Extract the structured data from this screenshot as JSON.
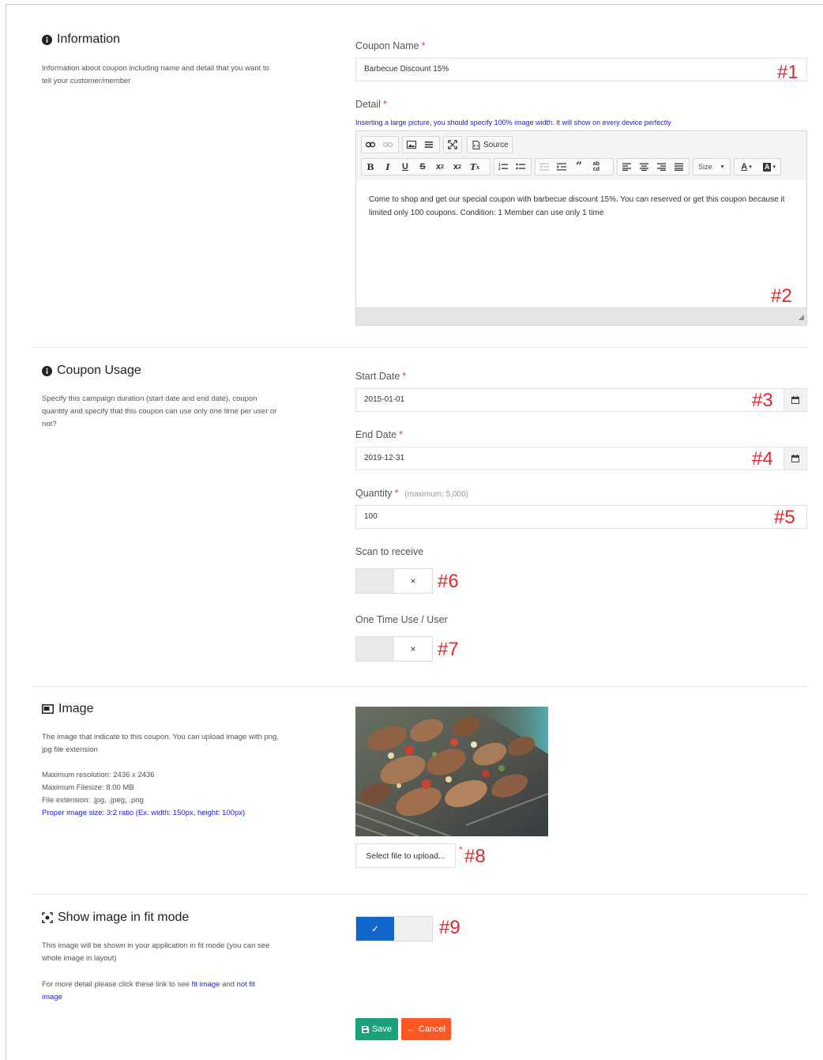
{
  "sections": {
    "information": {
      "title": "Information",
      "description": "Information about coupon including name and detail that you want to tell your customer/member"
    },
    "usage": {
      "title": "Coupon Usage",
      "description": "Specify this campaign duration (start date and end date), coupon quantity and specify that this coupon can use only one time per user or not?"
    },
    "image": {
      "title": "Image",
      "description": "The image that indicate to this coupon. You can upload image with png, jpg file extension",
      "max_resolution": "Maximum resolution: 2436 x 2436",
      "max_filesize": "Maximum Filesize: 8.00 MB",
      "file_extension": "File extension: .jpg, .jpeg, .png",
      "proper_size": "Proper image size: 3:2 ratio (Ex. width: 150px, height: 100px)"
    },
    "fit": {
      "title": "Show image in fit mode",
      "description": "This image will be shown in your application in fit mode (you can see whole image in layout)",
      "more_prefix": "For more detail please click these link to see",
      "fit_link": "fit image",
      "and": "and",
      "not_fit_link": "not fit image"
    }
  },
  "fields": {
    "coupon_name": {
      "label": "Coupon Name",
      "required": "*",
      "value": "Barbecue Discount 15%"
    },
    "detail": {
      "label": "Detail",
      "required": "*",
      "hint": "Inserting a large picture, you should specify 100% image width. It will show on every device perfectly",
      "content": "Come to shop and get our special coupon with barbecue discount 15%. You can reserved or get this coupon because it limited only 100 coupons. Condition: 1 Member can use only 1 time",
      "source_label": "Source",
      "size_label": "Size"
    },
    "start_date": {
      "label": "Start Date",
      "required": "*",
      "value": "2015-01-01"
    },
    "end_date": {
      "label": "End Date",
      "required": "*",
      "value": "2019-12-31"
    },
    "quantity": {
      "label": "Quantity",
      "required": "*",
      "hint": "(maximum: 5,000)",
      "value": "100"
    },
    "scan_to_receive": {
      "label": "Scan to receive",
      "state": "off",
      "off_symbol": "×"
    },
    "one_time_use": {
      "label": "One Time Use / User",
      "state": "off",
      "off_symbol": "×"
    },
    "image_upload": {
      "button_label": "Select file to upload...",
      "required": "*"
    },
    "fit_mode": {
      "state": "on",
      "on_symbol": "✓"
    }
  },
  "annotations": [
    "#1",
    "#2",
    "#3",
    "#4",
    "#5",
    "#6",
    "#7",
    "#8",
    "#9"
  ],
  "actions": {
    "save_label": "Save",
    "cancel_label": "Cancel"
  },
  "colors": {
    "annotation": "#e8262a",
    "save": "#1aa37a",
    "cancel": "#ff5722",
    "toggle_on": "#0f67cc",
    "link": "#1a1aff"
  }
}
